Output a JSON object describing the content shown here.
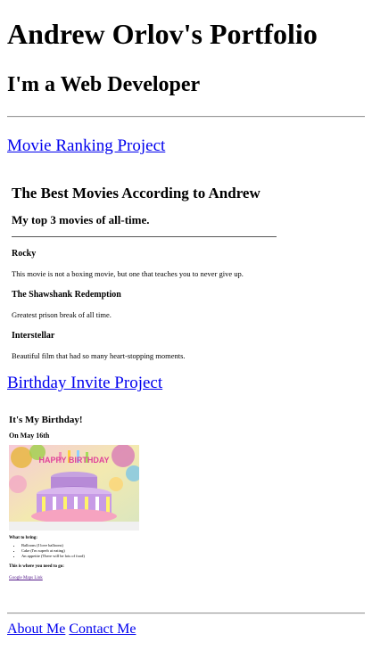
{
  "header": {
    "title": "Andrew Orlov's Portfolio",
    "subtitle": "I'm a Web Developer"
  },
  "projects": [
    {
      "link_label": "Movie Ranking Project",
      "frame": {
        "title": "The Best Movies According to Andrew",
        "subtitle": "My top 3 movies of all-time.",
        "movies": [
          {
            "title": "Rocky",
            "description": "This movie is not a boxing movie, but one that teaches you to never give up."
          },
          {
            "title": "The Shawshank Redemption",
            "description": "Greatest prison break of all time."
          },
          {
            "title": "Interstellar",
            "description": "Beautiful film that had so many heart-stopping moments."
          }
        ]
      }
    },
    {
      "link_label": "Birthday Invite Project",
      "frame": {
        "title": "It's My Birthday!",
        "date": "On May 16th",
        "cake_text": "HAPPY BIRTHDAY",
        "bring_heading": "What to bring:",
        "bring_items": [
          "Balloons (I love balloons)",
          "Cake (I'm superb at eating)",
          "An appetite (There will be lots of food)"
        ],
        "where_heading": "This is where you need to go:",
        "map_link": "Google Maps Link"
      }
    }
  ],
  "footer": {
    "about_label": "About Me",
    "contact_label": "Contact Me"
  }
}
